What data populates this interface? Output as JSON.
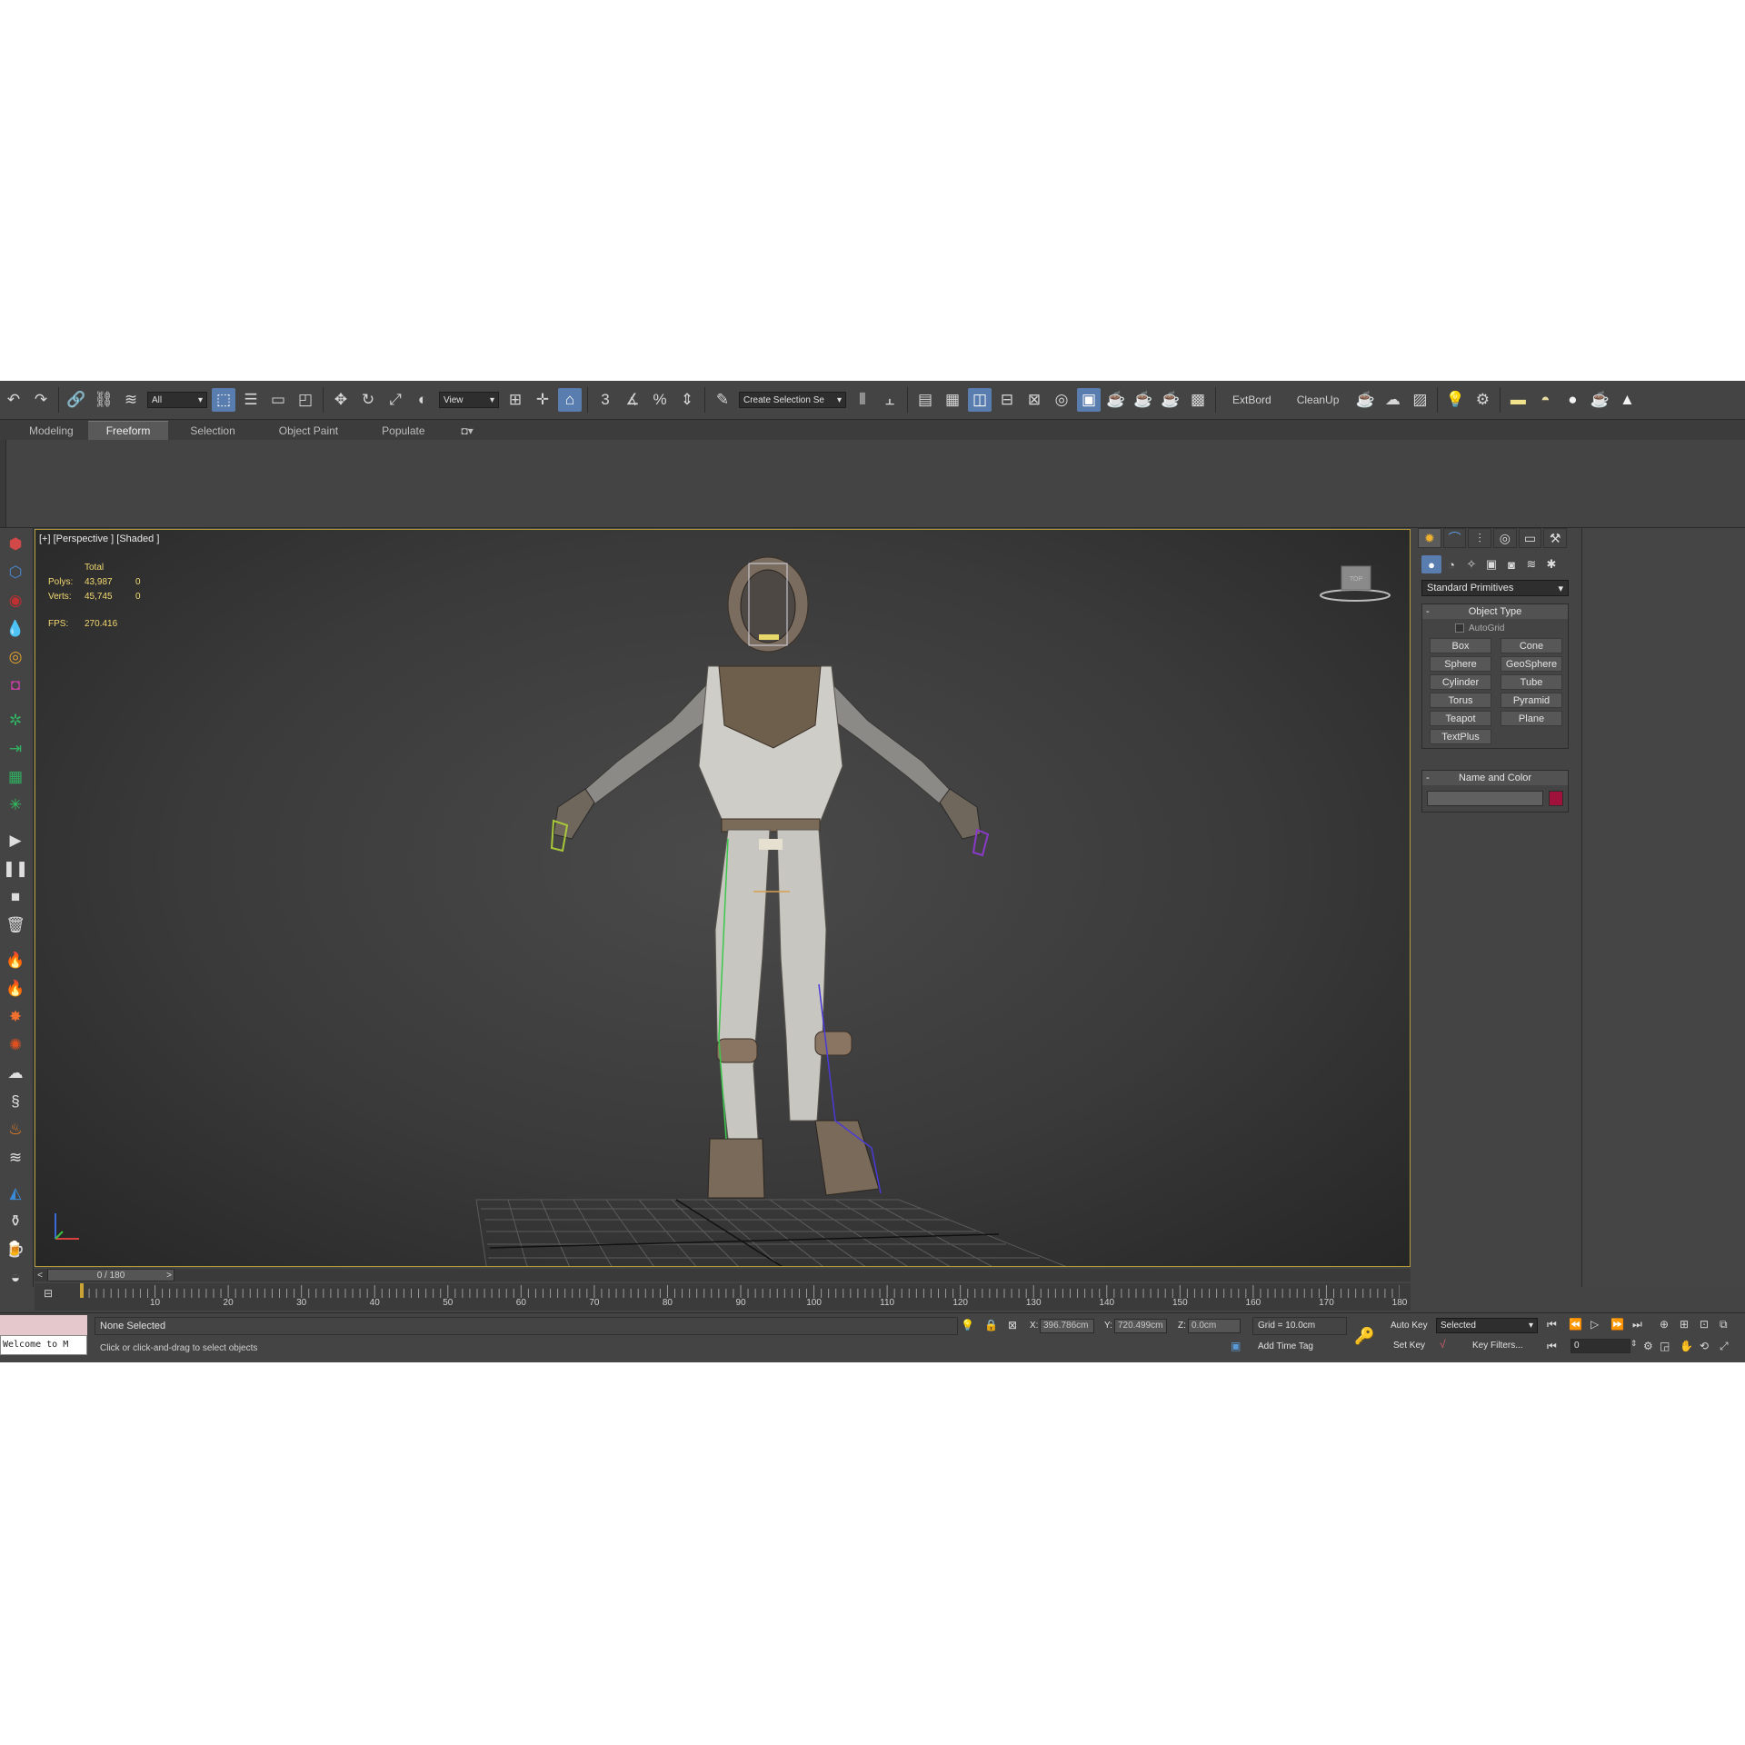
{
  "toolbar": {
    "selection_filter": "All",
    "ref_coord": "View",
    "snap_label": "3",
    "named_selection_placeholder": "Create Selection Se",
    "extbord_label": "ExtBord",
    "cleanup_label": "CleanUp"
  },
  "ribbon": {
    "tabs": [
      "Modeling",
      "Freeform",
      "Selection",
      "Object Paint",
      "Populate"
    ],
    "active_tab": "Freeform"
  },
  "viewport": {
    "label": "[+] [Perspective ] [Shaded ]",
    "stats": {
      "header": "Total",
      "polys_label": "Polys:",
      "polys_total": "43,987",
      "polys_sel": "0",
      "verts_label": "Verts:",
      "verts_total": "45,745",
      "verts_sel": "0",
      "fps_label": "FPS:",
      "fps_value": "270.416"
    },
    "viewcube_label": "TOP"
  },
  "command_panel": {
    "category": "Standard Primitives",
    "object_type_title": "Object Type",
    "autogrid_label": "AutoGrid",
    "primitives": [
      "Box",
      "Cone",
      "Sphere",
      "GeoSphere",
      "Cylinder",
      "Tube",
      "Torus",
      "Pyramid",
      "Teapot",
      "Plane",
      "TextPlus"
    ],
    "name_color_title": "Name and Color",
    "object_color": "#a0123c"
  },
  "timeline": {
    "frame_display": "0 / 180",
    "ticks": [
      "10",
      "20",
      "30",
      "40",
      "50",
      "60",
      "70",
      "80",
      "90",
      "100",
      "110",
      "120",
      "130",
      "140",
      "150",
      "160",
      "170",
      "180"
    ],
    "current_frame": 0,
    "total_frames": 180
  },
  "status": {
    "maxscript_text": "Welcome to M",
    "selection": "None Selected",
    "prompt": "Click or click-and-drag to select objects",
    "x_label": "X:",
    "x_value": "396.786cm",
    "y_label": "Y:",
    "y_value": "720.499cm",
    "z_label": "Z:",
    "z_value": "0.0cm",
    "grid": "Grid = 10.0cm",
    "add_time_tag": "Add Time Tag",
    "auto_key": "Auto Key",
    "set_key": "Set Key",
    "key_mode": "Selected",
    "key_filters": "Key Filters...",
    "frame_value": "0"
  }
}
